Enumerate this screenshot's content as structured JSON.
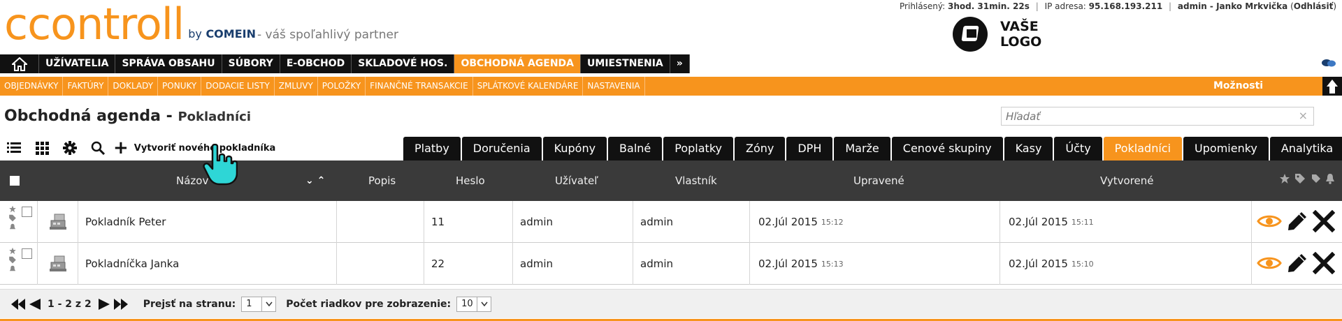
{
  "brand": {
    "logo_text": "ccontroll",
    "by": "by",
    "company": "COMEIN",
    "tagline": "- váš spoľahlivý partner",
    "your_logo_line1": "VAŠE",
    "your_logo_line2": "LOGO"
  },
  "session": {
    "logged_label": "Prihlásený:",
    "logged_time": "3hod. 31min. 22s",
    "ip_label": "IP adresa:",
    "ip": "95.168.193.211",
    "user": "admin - Janko Mrkvička",
    "logout": "Odhlásiť"
  },
  "main_nav": {
    "items": [
      {
        "label": "UŽÍVATELIA"
      },
      {
        "label": "SPRÁVA OBSAHU"
      },
      {
        "label": "SÚBORY"
      },
      {
        "label": "E-OBCHOD"
      },
      {
        "label": "SKLADOVÉ HOS."
      },
      {
        "label": "OBCHODNÁ AGENDA",
        "active": true
      },
      {
        "label": "UMIESTNENIA"
      },
      {
        "label": "»"
      }
    ]
  },
  "sub_nav": {
    "items": [
      "OBJEDNÁVKY",
      "FAKTÚRY",
      "DOKLADY",
      "PONUKY",
      "DODACIE LISTY",
      "ZMLUVY",
      "POLOŽKY",
      "FINANČNÉ TRANSAKCIE",
      "SPLÁTKOVÉ KALENDÁRE",
      "NASTAVENIA"
    ],
    "options": "Možnosti"
  },
  "page": {
    "title": "Obchodná agenda",
    "dash": "-",
    "subtitle": "Pokladníci"
  },
  "search": {
    "placeholder": "Hľadať",
    "clear": "×"
  },
  "toolbar": {
    "create_label": "Vytvoriť nového pokladníka"
  },
  "tabs": [
    {
      "label": "Platby"
    },
    {
      "label": "Doručenia"
    },
    {
      "label": "Kupóny"
    },
    {
      "label": "Balné"
    },
    {
      "label": "Poplatky"
    },
    {
      "label": "Zóny"
    },
    {
      "label": "DPH"
    },
    {
      "label": "Marže"
    },
    {
      "label": "Cenové skupiny"
    },
    {
      "label": "Kasy"
    },
    {
      "label": "Účty"
    },
    {
      "label": "Pokladníci",
      "active": true
    },
    {
      "label": "Upomienky"
    },
    {
      "label": "Analytika"
    }
  ],
  "table": {
    "columns": {
      "name": "Názov",
      "desc": "Popis",
      "password": "Heslo",
      "user": "Užívateľ",
      "owner": "Vlastník",
      "updated": "Upravené",
      "created": "Vytvorené"
    },
    "sort_arrows": "⌄ ⌃",
    "rows": [
      {
        "name": "Pokladník Peter",
        "desc": "",
        "password": "11",
        "user": "admin",
        "owner": "admin",
        "updated_date": "02.Júl 2015",
        "updated_time": "15:12",
        "created_date": "02.Júl 2015",
        "created_time": "15:11"
      },
      {
        "name": "Pokladníčka Janka",
        "desc": "",
        "password": "22",
        "user": "admin",
        "owner": "admin",
        "updated_date": "02.Júl 2015",
        "updated_time": "15:13",
        "created_date": "02.Júl 2015",
        "created_time": "15:10"
      }
    ]
  },
  "pager": {
    "range": "1 - 2 z 2",
    "goto_label": "Prejsť na stranu:",
    "page_value": "1",
    "rows_label": "Počet riadkov pre zobrazenie:",
    "rows_value": "10"
  },
  "colors": {
    "accent": "#f7941d",
    "dark": "#111111",
    "header_bg": "#3a3a3a"
  }
}
